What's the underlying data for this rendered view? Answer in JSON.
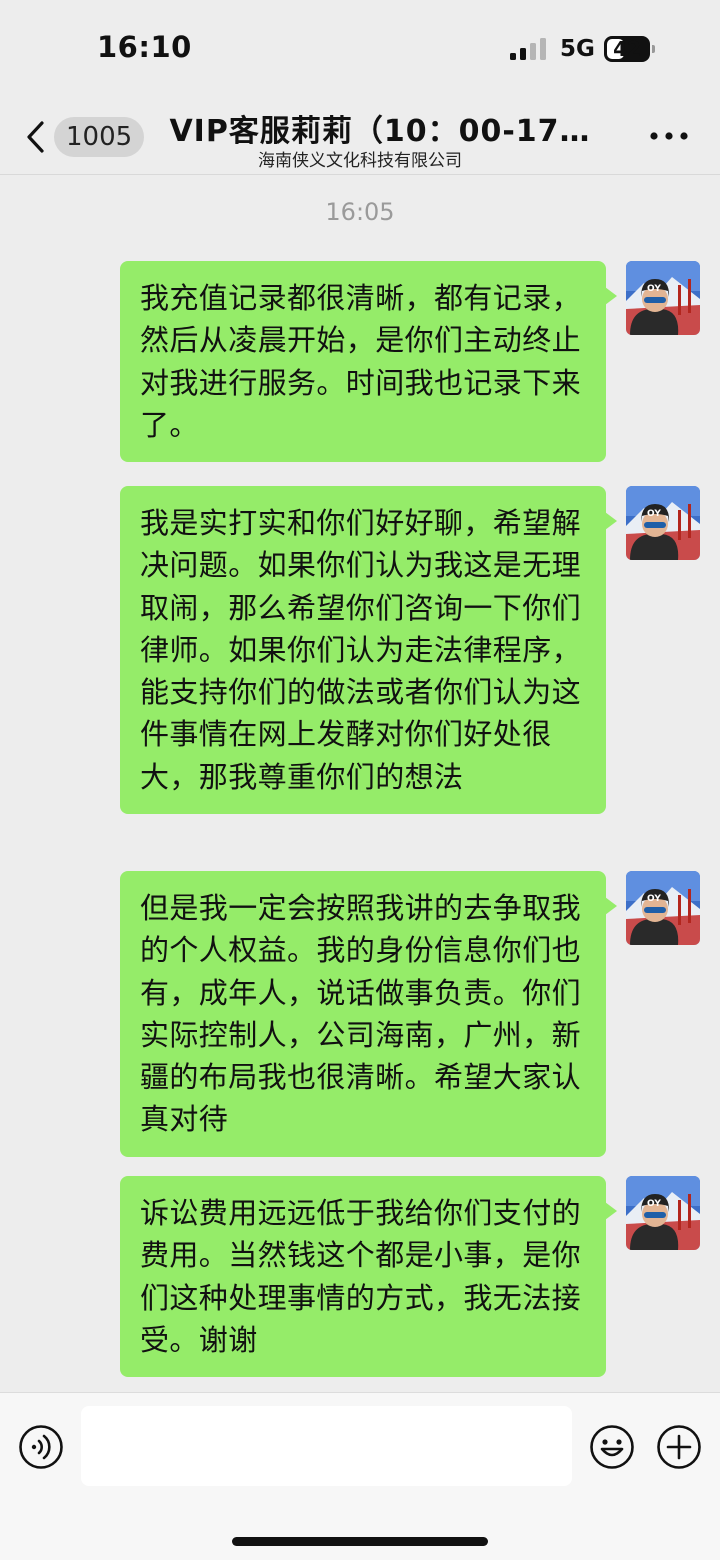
{
  "status_bar": {
    "time": "16:10",
    "network": "5G",
    "battery": "42",
    "battery_percent": 42
  },
  "header": {
    "unread_count": "1005",
    "title": "VIP客服莉莉（10：00-17…",
    "subtitle": "海南侠义文化科技有限公司"
  },
  "chat": {
    "timestamp": "16:05",
    "messages": [
      {
        "sender": "self",
        "text": "我充值记录都很清晰，都有记录，然后从凌晨开始，是你们主动终止对我进行服务。时间我也记录下来了。"
      },
      {
        "sender": "self",
        "text": "我是实打实和你们好好聊，希望解决问题。如果你们认为我这是无理取闹，那么希望你们咨询一下你们律师。如果你们认为走法律程序，能支持你们的做法或者你们认为这件事情在网上发酵对你们好处很大，那我尊重你们的想法"
      },
      {
        "sender": "self",
        "text": "但是我一定会按照我讲的去争取我的个人权益。我的身份信息你们也有，成年人，说话做事负责。你们实际控制人，公司海南，广州，新疆的布局我也很清晰。希望大家认真对待"
      },
      {
        "sender": "self",
        "text": "诉讼费用远远低于我给你们支付的费用。当然钱这个都是小事，是你们这种处理事情的方式，我无法接受。谢谢"
      }
    ]
  },
  "input_bar": {
    "placeholder": "",
    "icons": [
      "voice-icon",
      "emoji-icon",
      "plus-icon"
    ]
  },
  "colors": {
    "background": "#ededed",
    "sent_bubble": "#95ec69",
    "timestamp": "#9a9a9a"
  }
}
